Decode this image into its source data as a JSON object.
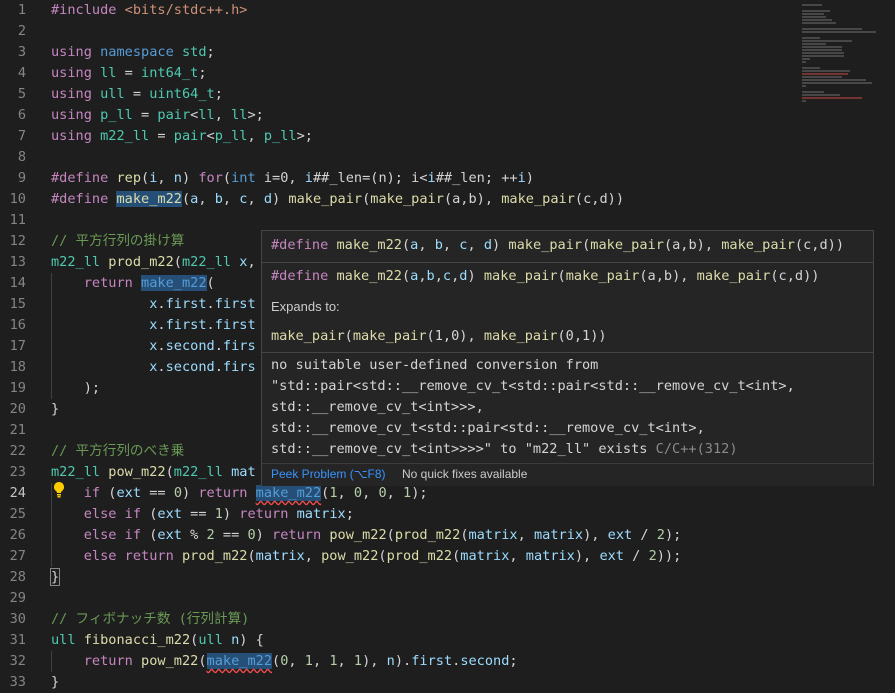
{
  "lines": [
    {
      "n": "1",
      "tokens": [
        [
          "pp",
          "#include "
        ],
        [
          "str",
          "<bits/stdc++.h>"
        ]
      ]
    },
    {
      "n": "2",
      "tokens": []
    },
    {
      "n": "3",
      "tokens": [
        [
          "pp",
          "using"
        ],
        [
          "op",
          " "
        ],
        [
          "kw",
          "namespace"
        ],
        [
          "op",
          " "
        ],
        [
          "type",
          "std"
        ],
        [
          "op",
          ";"
        ]
      ]
    },
    {
      "n": "4",
      "tokens": [
        [
          "pp",
          "using"
        ],
        [
          "op",
          " "
        ],
        [
          "type",
          "ll"
        ],
        [
          "op",
          " = "
        ],
        [
          "type",
          "int64_t"
        ],
        [
          "op",
          ";"
        ]
      ]
    },
    {
      "n": "5",
      "tokens": [
        [
          "pp",
          "using"
        ],
        [
          "op",
          " "
        ],
        [
          "type",
          "ull"
        ],
        [
          "op",
          " = "
        ],
        [
          "type",
          "uint64_t"
        ],
        [
          "op",
          ";"
        ]
      ]
    },
    {
      "n": "6",
      "tokens": [
        [
          "pp",
          "using"
        ],
        [
          "op",
          " "
        ],
        [
          "type",
          "p_ll"
        ],
        [
          "op",
          " = "
        ],
        [
          "type",
          "pair"
        ],
        [
          "op",
          "<"
        ],
        [
          "type",
          "ll"
        ],
        [
          "op",
          ", "
        ],
        [
          "type",
          "ll"
        ],
        [
          "op",
          ">;"
        ]
      ]
    },
    {
      "n": "7",
      "tokens": [
        [
          "pp",
          "using"
        ],
        [
          "op",
          " "
        ],
        [
          "type",
          "m22_ll"
        ],
        [
          "op",
          " = "
        ],
        [
          "type",
          "pair"
        ],
        [
          "op",
          "<"
        ],
        [
          "type",
          "p_ll"
        ],
        [
          "op",
          ", "
        ],
        [
          "type",
          "p_ll"
        ],
        [
          "op",
          ">;"
        ]
      ]
    },
    {
      "n": "8",
      "tokens": []
    },
    {
      "n": "9",
      "tokens": [
        [
          "pp",
          "#define "
        ],
        [
          "fn",
          "rep"
        ],
        [
          "op",
          "("
        ],
        [
          "var",
          "i"
        ],
        [
          "op",
          ", "
        ],
        [
          "var",
          "n"
        ],
        [
          "op",
          ") "
        ],
        [
          "ctl",
          "for"
        ],
        [
          "op",
          "("
        ],
        [
          "kw",
          "int"
        ],
        [
          "op",
          " i=0, "
        ],
        [
          "var",
          "i"
        ],
        [
          "op",
          "##_len=(n); i<"
        ],
        [
          "var",
          "i"
        ],
        [
          "op",
          "##_len; ++"
        ],
        [
          "var",
          "i"
        ],
        [
          "op",
          ")"
        ]
      ]
    },
    {
      "n": "10",
      "tokens": [
        [
          "pp",
          "#define "
        ],
        [
          "fn hl",
          "make_m22"
        ],
        [
          "op",
          "("
        ],
        [
          "var",
          "a"
        ],
        [
          "op",
          ", "
        ],
        [
          "var",
          "b"
        ],
        [
          "op",
          ", "
        ],
        [
          "var",
          "c"
        ],
        [
          "op",
          ", "
        ],
        [
          "var",
          "d"
        ],
        [
          "op",
          ") "
        ],
        [
          "fn",
          "make_pair"
        ],
        [
          "op",
          "("
        ],
        [
          "fn",
          "make_pair"
        ],
        [
          "op",
          "(a,b), "
        ],
        [
          "fn",
          "make_pair"
        ],
        [
          "op",
          "(c,d))"
        ]
      ]
    },
    {
      "n": "11",
      "tokens": []
    },
    {
      "n": "12",
      "tokens": [
        [
          "cmt",
          "// 平方行列の掛け算"
        ]
      ]
    },
    {
      "n": "13",
      "tokens": [
        [
          "type",
          "m22_ll"
        ],
        [
          "op",
          " "
        ],
        [
          "fn",
          "prod_m22"
        ],
        [
          "op",
          "("
        ],
        [
          "type",
          "m22_ll"
        ],
        [
          "op",
          " "
        ],
        [
          "var",
          "x"
        ],
        [
          "op",
          ","
        ]
      ]
    },
    {
      "n": "14",
      "tokens": [
        [
          "op",
          "    "
        ],
        [
          "ctl",
          "return"
        ],
        [
          "op",
          " "
        ],
        [
          "macro hl",
          "make_m22"
        ],
        [
          "op",
          "("
        ]
      ]
    },
    {
      "n": "15",
      "tokens": [
        [
          "op",
          "            "
        ],
        [
          "var",
          "x"
        ],
        [
          "op",
          "."
        ],
        [
          "var",
          "first"
        ],
        [
          "op",
          "."
        ],
        [
          "var",
          "first"
        ]
      ]
    },
    {
      "n": "16",
      "tokens": [
        [
          "op",
          "            "
        ],
        [
          "var",
          "x"
        ],
        [
          "op",
          "."
        ],
        [
          "var",
          "first"
        ],
        [
          "op",
          "."
        ],
        [
          "var",
          "first"
        ]
      ]
    },
    {
      "n": "17",
      "tokens": [
        [
          "op",
          "            "
        ],
        [
          "var",
          "x"
        ],
        [
          "op",
          "."
        ],
        [
          "var",
          "second"
        ],
        [
          "op",
          "."
        ],
        [
          "var",
          "firs"
        ]
      ]
    },
    {
      "n": "18",
      "tokens": [
        [
          "op",
          "            "
        ],
        [
          "var",
          "x"
        ],
        [
          "op",
          "."
        ],
        [
          "var",
          "second"
        ],
        [
          "op",
          "."
        ],
        [
          "var",
          "firs"
        ]
      ]
    },
    {
      "n": "19",
      "tokens": [
        [
          "op",
          "    );"
        ]
      ]
    },
    {
      "n": "20",
      "tokens": [
        [
          "op",
          "}"
        ]
      ]
    },
    {
      "n": "21",
      "tokens": []
    },
    {
      "n": "22",
      "tokens": [
        [
          "cmt",
          "// 平方行列のべき乗"
        ]
      ]
    },
    {
      "n": "23",
      "tokens": [
        [
          "type",
          "m22_ll"
        ],
        [
          "op",
          " "
        ],
        [
          "fn",
          "pow_m22"
        ],
        [
          "op",
          "("
        ],
        [
          "type",
          "m22_ll"
        ],
        [
          "op",
          " "
        ],
        [
          "var",
          "mat"
        ]
      ]
    },
    {
      "n": "24",
      "tokens": [
        [
          "op",
          "    "
        ],
        [
          "ctl",
          "if"
        ],
        [
          "op",
          " ("
        ],
        [
          "var",
          "ext"
        ],
        [
          "op",
          " == "
        ],
        [
          "num",
          "0"
        ],
        [
          "op",
          ") "
        ],
        [
          "ctl",
          "return"
        ],
        [
          "op",
          " "
        ],
        [
          "macro hl squiggle",
          "make_m22"
        ],
        [
          "op",
          "("
        ],
        [
          "num",
          "1"
        ],
        [
          "op",
          ", "
        ],
        [
          "num",
          "0"
        ],
        [
          "op",
          ", "
        ],
        [
          "num",
          "0"
        ],
        [
          "op",
          ", "
        ],
        [
          "num",
          "1"
        ],
        [
          "op",
          ");"
        ]
      ]
    },
    {
      "n": "25",
      "tokens": [
        [
          "op",
          "    "
        ],
        [
          "ctl",
          "else if"
        ],
        [
          "op",
          " ("
        ],
        [
          "var",
          "ext"
        ],
        [
          "op",
          " == "
        ],
        [
          "num",
          "1"
        ],
        [
          "op",
          ") "
        ],
        [
          "ctl",
          "return"
        ],
        [
          "op",
          " "
        ],
        [
          "var",
          "matrix"
        ],
        [
          "op",
          ";"
        ]
      ]
    },
    {
      "n": "26",
      "tokens": [
        [
          "op",
          "    "
        ],
        [
          "ctl",
          "else if"
        ],
        [
          "op",
          " ("
        ],
        [
          "var",
          "ext"
        ],
        [
          "op",
          " % "
        ],
        [
          "num",
          "2"
        ],
        [
          "op",
          " == "
        ],
        [
          "num",
          "0"
        ],
        [
          "op",
          ") "
        ],
        [
          "ctl",
          "return"
        ],
        [
          "op",
          " "
        ],
        [
          "fn",
          "pow_m22"
        ],
        [
          "op",
          "("
        ],
        [
          "fn",
          "prod_m22"
        ],
        [
          "op",
          "("
        ],
        [
          "var",
          "matrix"
        ],
        [
          "op",
          ", "
        ],
        [
          "var",
          "matrix"
        ],
        [
          "op",
          "), "
        ],
        [
          "var",
          "ext"
        ],
        [
          "op",
          " / "
        ],
        [
          "num",
          "2"
        ],
        [
          "op",
          ");"
        ]
      ]
    },
    {
      "n": "27",
      "tokens": [
        [
          "op",
          "    "
        ],
        [
          "ctl",
          "else return"
        ],
        [
          "op",
          " "
        ],
        [
          "fn",
          "prod_m22"
        ],
        [
          "op",
          "("
        ],
        [
          "var",
          "matrix"
        ],
        [
          "op",
          ", "
        ],
        [
          "fn",
          "pow_m22"
        ],
        [
          "op",
          "("
        ],
        [
          "fn",
          "prod_m22"
        ],
        [
          "op",
          "("
        ],
        [
          "var",
          "matrix"
        ],
        [
          "op",
          ", "
        ],
        [
          "var",
          "matrix"
        ],
        [
          "op",
          "), "
        ],
        [
          "var",
          "ext"
        ],
        [
          "op",
          " / "
        ],
        [
          "num",
          "2"
        ],
        [
          "op",
          "));"
        ]
      ]
    },
    {
      "n": "28",
      "tokens": [
        [
          "op brace-box",
          "}"
        ]
      ]
    },
    {
      "n": "29",
      "tokens": []
    },
    {
      "n": "30",
      "tokens": [
        [
          "cmt",
          "// フィボナッチ数 (行列計算)"
        ]
      ]
    },
    {
      "n": "31",
      "tokens": [
        [
          "type",
          "ull"
        ],
        [
          "op",
          " "
        ],
        [
          "fn",
          "fibonacci_m22"
        ],
        [
          "op",
          "("
        ],
        [
          "type",
          "ull"
        ],
        [
          "op",
          " "
        ],
        [
          "var",
          "n"
        ],
        [
          "op",
          ") {"
        ]
      ]
    },
    {
      "n": "32",
      "tokens": [
        [
          "op",
          "    "
        ],
        [
          "ctl",
          "return"
        ],
        [
          "op",
          " "
        ],
        [
          "fn",
          "pow_m22"
        ],
        [
          "op",
          "("
        ],
        [
          "macro hl squiggle",
          "make_m22"
        ],
        [
          "op",
          "("
        ],
        [
          "num",
          "0"
        ],
        [
          "op",
          ", "
        ],
        [
          "num",
          "1"
        ],
        [
          "op",
          ", "
        ],
        [
          "num",
          "1"
        ],
        [
          "op",
          ", "
        ],
        [
          "num",
          "1"
        ],
        [
          "op",
          "), "
        ],
        [
          "var",
          "n"
        ],
        [
          "op",
          ")."
        ],
        [
          "var",
          "first"
        ],
        [
          "op",
          "."
        ],
        [
          "var",
          "second"
        ],
        [
          "op",
          ";"
        ]
      ]
    },
    {
      "n": "33",
      "tokens": [
        [
          "op",
          "}"
        ]
      ]
    }
  ],
  "current_line": "24",
  "hover": {
    "def1": [
      [
        "pp",
        "#define "
      ],
      [
        "fn",
        "make_m22"
      ],
      [
        "op",
        "("
      ],
      [
        "var",
        "a"
      ],
      [
        "op",
        ", "
      ],
      [
        "var",
        "b"
      ],
      [
        "op",
        ", "
      ],
      [
        "var",
        "c"
      ],
      [
        "op",
        ", "
      ],
      [
        "var",
        "d"
      ],
      [
        "op",
        ") "
      ],
      [
        "fn",
        "make_pair"
      ],
      [
        "op",
        "("
      ],
      [
        "fn",
        "make_pair"
      ],
      [
        "op",
        "(a,b), "
      ],
      [
        "fn",
        "make_pair"
      ],
      [
        "op",
        "(c,d))"
      ]
    ],
    "def2": [
      [
        "pp",
        "#define "
      ],
      [
        "fn",
        "make_m22"
      ],
      [
        "op",
        "("
      ],
      [
        "var",
        "a"
      ],
      [
        "op",
        ","
      ],
      [
        "var",
        "b"
      ],
      [
        "op",
        ","
      ],
      [
        "var",
        "c"
      ],
      [
        "op",
        ","
      ],
      [
        "var",
        "d"
      ],
      [
        "op",
        ") "
      ],
      [
        "fn",
        "make_pair"
      ],
      [
        "op",
        "("
      ],
      [
        "fn",
        "make_pair"
      ],
      [
        "op",
        "(a,b), "
      ],
      [
        "fn",
        "make_pair"
      ],
      [
        "op",
        "(c,d))"
      ]
    ],
    "expands_label": "Expands to:",
    "expansion": [
      [
        "fn",
        "make_pair"
      ],
      [
        "op",
        "("
      ],
      [
        "fn",
        "make_pair"
      ],
      [
        "op",
        "(1,0), "
      ],
      [
        "fn",
        "make_pair"
      ],
      [
        "op",
        "(0,1))"
      ]
    ],
    "error_lines": [
      "no suitable user-defined conversion from",
      "\"std::pair<std::__remove_cv_t<std::pair<std::__remove_cv_t<int>,",
      "std::__remove_cv_t<int>>>,",
      "std::__remove_cv_t<std::pair<std::__remove_cv_t<int>,",
      "std::__remove_cv_t<int>>>>\" to \"m22_ll\" exists"
    ],
    "error_source": "C/C++(312)",
    "peek_label": "Peek Problem (⌥F8)",
    "no_fixes_label": "No quick fixes available"
  }
}
